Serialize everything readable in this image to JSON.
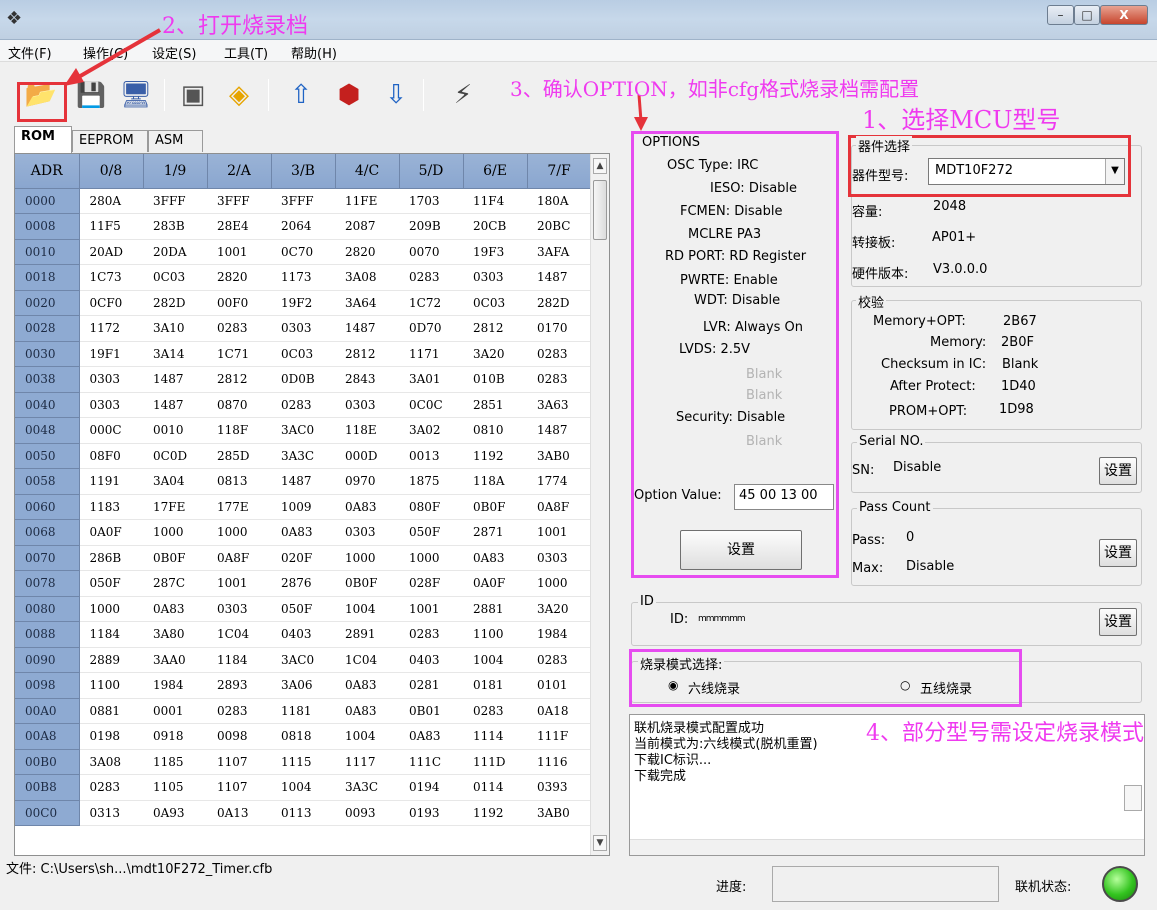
{
  "window": {
    "title_icon": "app-icon",
    "minimize": "–",
    "maximize": "□",
    "close": "X"
  },
  "menu": [
    "文件(F)",
    "操作(C)",
    "设定(S)",
    "工具(T)",
    "帮助(H)"
  ],
  "toolbar_icons": [
    "open-folder-icon",
    "save-icon",
    "download-icon",
    "ic-chip-icon",
    "eraser-icon",
    "upload-arrow-icon",
    "chip-red-icon",
    "download-arrow-icon",
    "connector-icon"
  ],
  "tabs": [
    "ROM",
    "EEPROM",
    "ASM"
  ],
  "grid": {
    "headers": [
      "ADR",
      "0/8",
      "1/9",
      "2/A",
      "3/B",
      "4/C",
      "5/D",
      "6/E",
      "7/F"
    ],
    "rows": [
      [
        "0000",
        "280A",
        "3FFF",
        "3FFF",
        "3FFF",
        "11FE",
        "1703",
        "11F4",
        "180A"
      ],
      [
        "0008",
        "11F5",
        "283B",
        "28E4",
        "2064",
        "2087",
        "209B",
        "20CB",
        "20BC"
      ],
      [
        "0010",
        "20AD",
        "20DA",
        "1001",
        "0C70",
        "2820",
        "0070",
        "19F3",
        "3AFA"
      ],
      [
        "0018",
        "1C73",
        "0C03",
        "2820",
        "1173",
        "3A08",
        "0283",
        "0303",
        "1487"
      ],
      [
        "0020",
        "0CF0",
        "282D",
        "00F0",
        "19F2",
        "3A64",
        "1C72",
        "0C03",
        "282D"
      ],
      [
        "0028",
        "1172",
        "3A10",
        "0283",
        "0303",
        "1487",
        "0D70",
        "2812",
        "0170"
      ],
      [
        "0030",
        "19F1",
        "3A14",
        "1C71",
        "0C03",
        "2812",
        "1171",
        "3A20",
        "0283"
      ],
      [
        "0038",
        "0303",
        "1487",
        "2812",
        "0D0B",
        "2843",
        "3A01",
        "010B",
        "0283"
      ],
      [
        "0040",
        "0303",
        "1487",
        "0870",
        "0283",
        "0303",
        "0C0C",
        "2851",
        "3A63"
      ],
      [
        "0048",
        "000C",
        "0010",
        "118F",
        "3AC0",
        "118E",
        "3A02",
        "0810",
        "1487"
      ],
      [
        "0050",
        "08F0",
        "0C0D",
        "285D",
        "3A3C",
        "000D",
        "0013",
        "1192",
        "3AB0"
      ],
      [
        "0058",
        "1191",
        "3A04",
        "0813",
        "1487",
        "0970",
        "1875",
        "118A",
        "1774"
      ],
      [
        "0060",
        "1183",
        "17FE",
        "177E",
        "1009",
        "0A83",
        "080F",
        "0B0F",
        "0A8F"
      ],
      [
        "0068",
        "0A0F",
        "1000",
        "1000",
        "0A83",
        "0303",
        "050F",
        "2871",
        "1001"
      ],
      [
        "0070",
        "286B",
        "0B0F",
        "0A8F",
        "020F",
        "1000",
        "1000",
        "0A83",
        "0303"
      ],
      [
        "0078",
        "050F",
        "287C",
        "1001",
        "2876",
        "0B0F",
        "028F",
        "0A0F",
        "1000"
      ],
      [
        "0080",
        "1000",
        "0A83",
        "0303",
        "050F",
        "1004",
        "1001",
        "2881",
        "3A20"
      ],
      [
        "0088",
        "1184",
        "3A80",
        "1C04",
        "0403",
        "2891",
        "0283",
        "1100",
        "1984"
      ],
      [
        "0090",
        "2889",
        "3AA0",
        "1184",
        "3AC0",
        "1C04",
        "0403",
        "1004",
        "0283"
      ],
      [
        "0098",
        "1100",
        "1984",
        "2893",
        "3A06",
        "0A83",
        "0281",
        "0181",
        "0101"
      ],
      [
        "00A0",
        "0881",
        "0001",
        "0283",
        "1181",
        "0A83",
        "0B01",
        "0283",
        "0A18"
      ],
      [
        "00A8",
        "0198",
        "0918",
        "0098",
        "0818",
        "1004",
        "0A83",
        "1114",
        "111F"
      ],
      [
        "00B0",
        "3A08",
        "1185",
        "1107",
        "1115",
        "1117",
        "111C",
        "111D",
        "1116"
      ],
      [
        "00B8",
        "0283",
        "1105",
        "1107",
        "1004",
        "3A3C",
        "0194",
        "0114",
        "0393"
      ],
      [
        "00C0",
        "0313",
        "0A93",
        "0A13",
        "0113",
        "0093",
        "0193",
        "1192",
        "3AB0"
      ]
    ]
  },
  "file_path": "文件: C:\\Users\\sh...\\mdt10F272_Timer.cfb",
  "options": {
    "legend": "OPTIONS",
    "osc": "OSC Type: IRC",
    "ieso": "IESO: Disable",
    "fcmen": "FCMEN: Disable",
    "mclre": "MCLRE PA3",
    "rdport": "RD PORT: RD Register",
    "pwrte": "PWRTE: Enable",
    "wdt": "WDT: Disable",
    "lvr": "LVR: Always On",
    "lvds": "LVDS: 2.5V",
    "blank1": "Blank",
    "blank2": "Blank",
    "security": "Security: Disable",
    "blank3": "Blank",
    "value_label": "Option Value:",
    "value": "45 00 13 00",
    "set_button": "设置"
  },
  "device": {
    "legend": "器件选择",
    "model_label": "器件型号:",
    "model_value": "MDT10F272",
    "capacity_label": "容量:",
    "capacity_value": "2048",
    "adapter_label": "转接板:",
    "adapter_value": "AP01+",
    "hw_label": "硬件版本:",
    "hw_value": "V3.0.0.0"
  },
  "checksum": {
    "legend": "校验",
    "mem_opt": "Memory+OPT:",
    "mem_opt_val": "2B67",
    "memory": "Memory:",
    "memory_val": "2B0F",
    "in_ic": "Checksum in IC:",
    "in_ic_val": "Blank",
    "after": "After Protect:",
    "after_val": "1D40",
    "prom": "PROM+OPT:",
    "prom_val": "1D98"
  },
  "serial": {
    "legend": "Serial NO.",
    "sn": "SN:",
    "sn_val": "Disable",
    "button": "设置"
  },
  "pass": {
    "legend": "Pass Count",
    "pass": "Pass:",
    "pass_val": "0",
    "max": "Max:",
    "max_val": "Disable",
    "button": "设置"
  },
  "id": {
    "legend": "ID",
    "label": "ID:",
    "value": "mmmmmm",
    "button": "设置"
  },
  "mode": {
    "legend": "烧录模式选择:",
    "six": "六线烧录",
    "five": "五线烧录"
  },
  "log": [
    "联机烧录模式配置成功",
    "当前模式为:六线模式(脱机重置)",
    "下载IC标识...",
    "下载完成"
  ],
  "status": {
    "progress_label": "进度:",
    "online_label": "联机状态:"
  },
  "annotations": {
    "a1": "1、选择MCU型号",
    "a2": "2、打开烧录档",
    "a3": "3、确认OPTION，如非cfg格式烧录档需配置",
    "a4": "4、部分型号需设定烧录模式"
  },
  "colors": {
    "annotation": "#ef3aef",
    "red_box": "#e5333a",
    "led": "#33c41f"
  }
}
